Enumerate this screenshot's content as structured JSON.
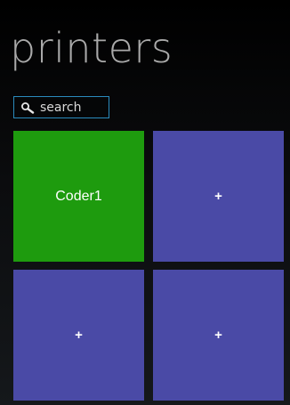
{
  "header": {
    "title": "printers"
  },
  "search": {
    "placeholder": "search",
    "icon": "search-icon"
  },
  "tiles": [
    {
      "label": "Coder1",
      "color": "#1e9b0e",
      "kind": "printer"
    },
    {
      "label": "+",
      "color": "#4a4aa6",
      "kind": "add"
    },
    {
      "label": "+",
      "color": "#4a4aa6",
      "kind": "add"
    },
    {
      "label": "+",
      "color": "#4a4aa6",
      "kind": "add"
    }
  ],
  "colors": {
    "accent_border": "#2a8bbd",
    "title_text": "#a9a9a9",
    "printer_tile": "#1e9b0e",
    "add_tile": "#4a4aa6"
  }
}
